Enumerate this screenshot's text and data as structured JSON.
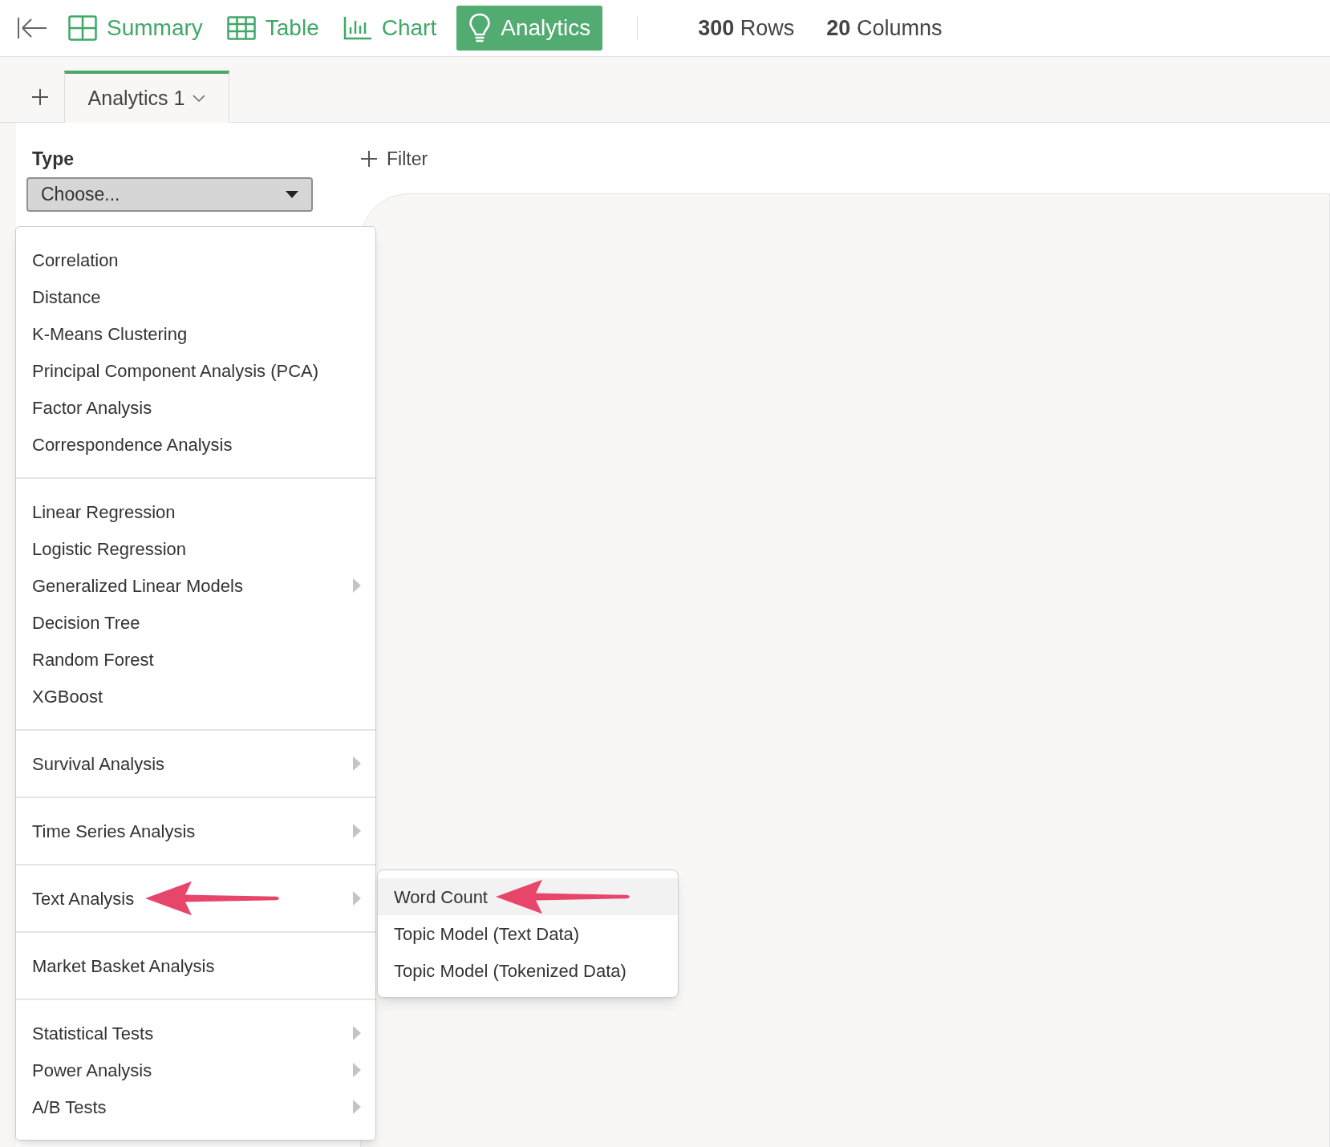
{
  "nav": {
    "items": [
      {
        "label": "Summary",
        "kind": "summary",
        "selected": false
      },
      {
        "label": "Table",
        "kind": "table",
        "selected": false
      },
      {
        "label": "Chart",
        "kind": "chart",
        "selected": false
      },
      {
        "label": "Analytics",
        "kind": "analytics",
        "selected": true
      }
    ],
    "stats": [
      "**300** Rows",
      "**20** Columns"
    ]
  },
  "tabs": [
    {
      "label": "Analytics 1",
      "selected": true
    }
  ],
  "type_label": "Type",
  "type_dropdown": {
    "value": "Choose..."
  },
  "filter_button": "Filter",
  "menu": {
    "groups": [
      [
        {
          "label": "Correlation",
          "has_submenu": false
        },
        {
          "label": "Distance",
          "has_submenu": false
        },
        {
          "label": "K-Means Clustering",
          "has_submenu": false
        },
        {
          "label": "Principal Component Analysis (PCA)",
          "has_submenu": false
        },
        {
          "label": "Factor Analysis",
          "has_submenu": false
        },
        {
          "label": "Correspondence Analysis",
          "has_submenu": false
        }
      ],
      [
        {
          "label": "Linear Regression",
          "has_submenu": false
        },
        {
          "label": "Logistic Regression",
          "has_submenu": false
        },
        {
          "label": "Generalized Linear Models",
          "has_submenu": true
        },
        {
          "label": "Decision Tree",
          "has_submenu": false
        },
        {
          "label": "Random Forest",
          "has_submenu": false
        },
        {
          "label": "XGBoost",
          "has_submenu": false
        }
      ],
      [
        {
          "label": "Survival Analysis",
          "has_submenu": true
        }
      ],
      [
        {
          "label": "Time Series Analysis",
          "has_submenu": true
        }
      ],
      [
        {
          "label": "Text Analysis",
          "has_submenu": true,
          "arrow": true
        }
      ],
      [
        {
          "label": "Market Basket Analysis",
          "has_submenu": false
        }
      ],
      [
        {
          "label": "Statistical Tests",
          "has_submenu": true
        },
        {
          "label": "Power Analysis",
          "has_submenu": true
        },
        {
          "label": "A/B Tests",
          "has_submenu": true
        }
      ]
    ]
  },
  "submenu": [
    {
      "label": "Word Count",
      "selected": true,
      "arrow": true
    },
    {
      "label": "Topic Model (Text Data)",
      "selected": false,
      "arrow": false
    },
    {
      "label": "Topic Model (Tokenized Data)",
      "selected": false,
      "arrow": false
    }
  ]
}
